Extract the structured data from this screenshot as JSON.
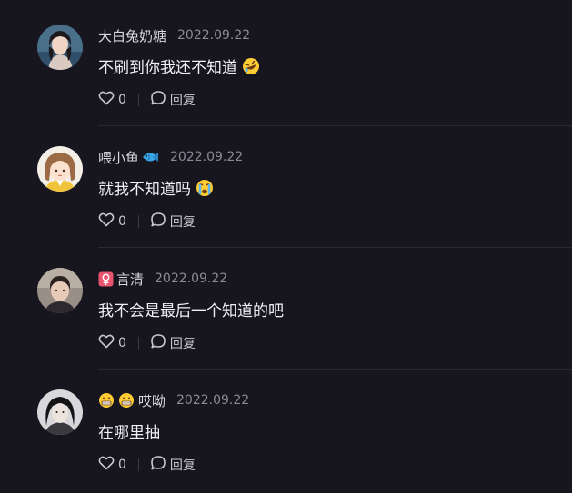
{
  "comments": [
    {
      "username": "大白兔奶糖",
      "date": "2022.09.22",
      "content": "不刷到你我还不知道",
      "content_emoji": "rofl-emoji",
      "likes": "0",
      "reply_label": "回复"
    },
    {
      "username": "喂小鱼",
      "username_emoji": "fish-emoji",
      "date": "2022.09.22",
      "content": "就我不知道吗",
      "content_emoji": "crying-emoji",
      "likes": "0",
      "reply_label": "回复"
    },
    {
      "username": "言清",
      "username_prefix_icon": "female-sign-icon",
      "date": "2022.09.22",
      "content": "我不会是最后一个知道的吧",
      "likes": "0",
      "reply_label": "回复"
    },
    {
      "username": "哎呦",
      "username_prefix_emoji": [
        "grimace-emoji",
        "grimace-emoji"
      ],
      "date": "2022.09.22",
      "content": "在哪里抽",
      "likes": "0",
      "reply_label": "回复"
    }
  ],
  "colors": {
    "background": "#17161f",
    "divider": "#2a2933",
    "muted_text": "#8b8b95",
    "female_badge": "#e8536e"
  }
}
